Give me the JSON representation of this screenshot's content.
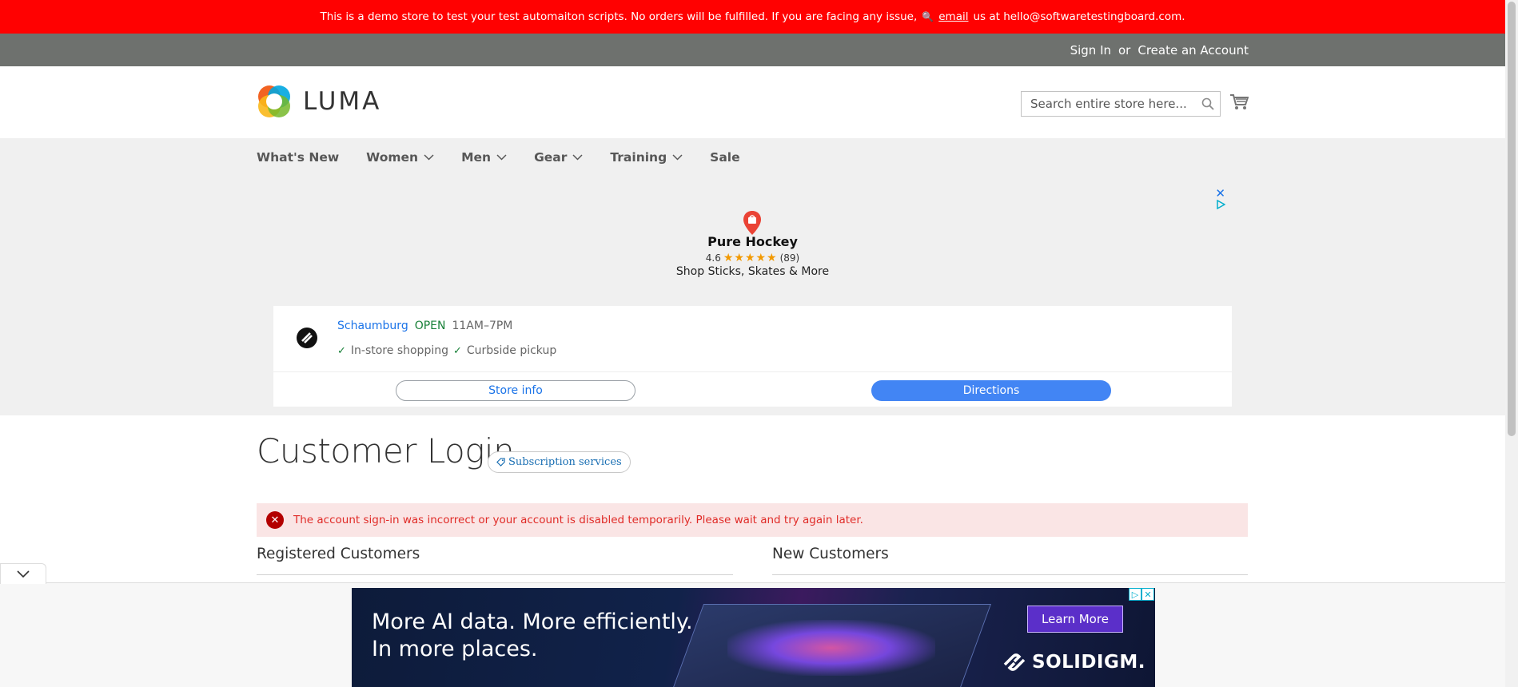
{
  "demo_banner": {
    "text": "This is a demo store to test your test automaiton scripts. No orders will be fulfilled. If you are facing any issue,",
    "link": "email",
    "suffix": "us at hello@softwaretestingboard.com."
  },
  "top_links": {
    "sign_in": "Sign In",
    "or": "or",
    "create_account": "Create an Account"
  },
  "header": {
    "logo_text": "LUMA",
    "search_placeholder": "Search entire store here..."
  },
  "nav": {
    "items": [
      {
        "label": "What's New",
        "dropdown": false
      },
      {
        "label": "Women",
        "dropdown": true
      },
      {
        "label": "Men",
        "dropdown": true
      },
      {
        "label": "Gear",
        "dropdown": true
      },
      {
        "label": "Training",
        "dropdown": true
      },
      {
        "label": "Sale",
        "dropdown": false
      }
    ]
  },
  "ad": {
    "store_name": "Pure Hockey",
    "rating": "4.6",
    "stars": "★★★★★",
    "reviews": "(89)",
    "tagline": "Shop Sticks, Skates & More",
    "city": "Schaumburg",
    "status": "OPEN",
    "hours": "11AM–7PM",
    "feature_1": "In-store shopping",
    "feature_2": "Curbside pickup",
    "store_info": "Store info",
    "directions": "Directions",
    "colors": {
      "link": "#1a73e8",
      "open": "#188038",
      "button": "#4285f4"
    }
  },
  "page": {
    "title": "Customer Login",
    "badge": "Subscription services",
    "error": "The account sign-in was incorrect or your account is disabled temporarily. Please wait and try again later.",
    "registered": "Registered Customers",
    "new_customers": "New Customers"
  },
  "bottom_ad": {
    "headline_1": "More AI data. More efficiently.",
    "headline_2": "In more places.",
    "cta": "Learn More",
    "brand": "SOLIDIGM."
  }
}
